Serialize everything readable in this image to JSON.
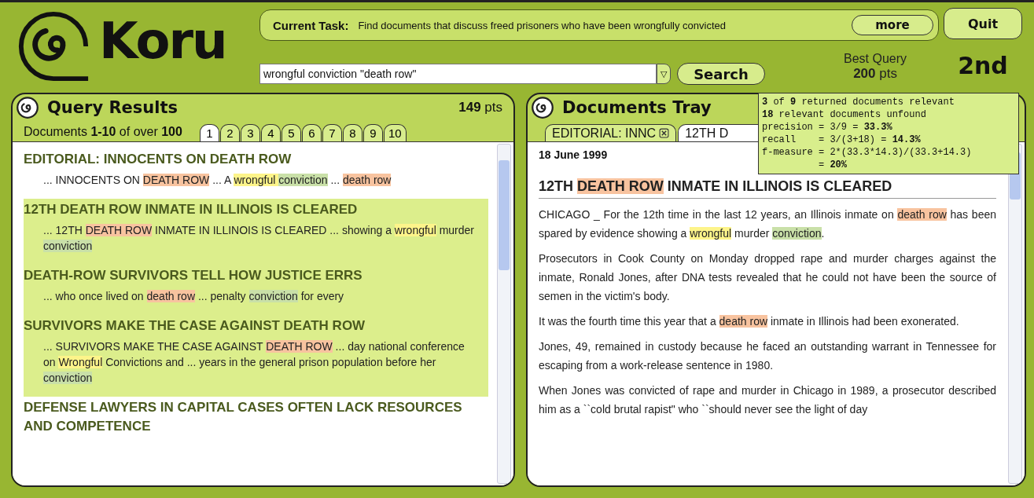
{
  "logo": {
    "text": "Koru"
  },
  "task": {
    "label": "Current Task:",
    "text": "Find documents that discuss freed prisoners who have been wrongfully convicted",
    "more_button": "more"
  },
  "quit_button": "Quit",
  "search": {
    "value": "wrongful conviction \"death row\"",
    "dropdown": "▽",
    "button": "Search"
  },
  "best_query": {
    "label": "Best Query",
    "points": "200",
    "unit": "pts"
  },
  "rank": "2nd",
  "score_tooltip": {
    "lines": [
      "**3** of **9** returned documents relevant",
      "**18** relevant documents unfound",
      "precision = 3/9 = **33.3%**",
      "recall    = 3/(3+18) = **14.3%**",
      "f-measure = 2*(33.3*14.3)/(33.3+14.3)",
      "          = **20%**"
    ]
  },
  "query_results": {
    "title": "Query Results",
    "points": "149",
    "unit": "pts",
    "summary": "Documents **1-10** of over **100**",
    "pages": [
      {
        "label": "1",
        "selected": true
      },
      {
        "label": "2",
        "selected": false
      },
      {
        "label": "3",
        "selected": false
      },
      {
        "label": "4",
        "selected": false
      },
      {
        "label": "5",
        "selected": false
      },
      {
        "label": "6",
        "selected": false
      },
      {
        "label": "7",
        "selected": false
      },
      {
        "label": "8",
        "selected": false
      },
      {
        "label": "9",
        "selected": false
      },
      {
        "label": "10",
        "selected": false
      }
    ],
    "results": [
      {
        "title": "EDITORIAL: INNOCENTS ON DEATH ROW",
        "highlighted": false,
        "snippet": [
          {
            "text": "... INNOCENTS ON "
          },
          {
            "text": "DEATH ROW",
            "color": "#f8c39f"
          },
          {
            "text": " ... A "
          },
          {
            "text": "wrongful ",
            "color": "#fdf48a"
          },
          {
            "text": "conviction",
            "color": "#c9e0a8"
          },
          {
            "text": " ... "
          },
          {
            "text": "death row",
            "color": "#f8c39f"
          }
        ]
      },
      {
        "title": "12TH DEATH ROW INMATE IN ILLINOIS IS CLEARED",
        "highlighted": true,
        "snippet": [
          {
            "text": "... 12TH "
          },
          {
            "text": "DEATH ROW",
            "color": "#f8c39f"
          },
          {
            "text": " INMATE IN ILLINOIS IS CLEARED ... showing a "
          },
          {
            "text": "wrongful",
            "color": "#fdf48a"
          },
          {
            "text": " murder "
          },
          {
            "text": "conviction",
            "color": "#c9e0a8"
          }
        ]
      },
      {
        "title": "DEATH-ROW SURVIVORS TELL HOW JUSTICE ERRS",
        "highlighted": true,
        "snippet": [
          {
            "text": "... who once lived on "
          },
          {
            "text": "death row",
            "color": "#f8c39f"
          },
          {
            "text": " ... penalty "
          },
          {
            "text": "conviction",
            "color": "#c9e0a8"
          },
          {
            "text": " for every"
          }
        ]
      },
      {
        "title": "SURVIVORS MAKE THE CASE AGAINST DEATH ROW",
        "highlighted": true,
        "snippet": [
          {
            "text": "... SURVIVORS MAKE THE CASE AGAINST "
          },
          {
            "text": "DEATH ROW",
            "color": "#f8c39f"
          },
          {
            "text": " ... day national conference on "
          },
          {
            "text": "Wrongful",
            "color": "#fdf48a"
          },
          {
            "text": " Convictions and ... years in the general prison population before her "
          },
          {
            "text": "conviction",
            "color": "#c9e0a8"
          }
        ]
      },
      {
        "title": "DEFENSE LAWYERS IN CAPITAL CASES OFTEN LACK RESOURCES AND COMPETENCE",
        "highlighted": false
      }
    ]
  },
  "documents_tray": {
    "title": "Documents Tray",
    "tabs": [
      {
        "label": "EDITORIAL: INNC",
        "selected": false,
        "closable": true
      },
      {
        "label": "12TH D",
        "selected": true,
        "closable": false
      }
    ],
    "document": {
      "date": "18 June 1999",
      "title": [
        {
          "text": "12TH "
        },
        {
          "text": "DEATH ROW",
          "color": "#f8c39f"
        },
        {
          "text": " INMATE IN ILLINOIS IS CLEARED"
        }
      ],
      "paragraphs": [
        [
          {
            "text": "CHICAGO _ For the 12th time in the last 12 years, an Illinois inmate on "
          },
          {
            "text": "death row",
            "color": "#f8c39f"
          },
          {
            "text": " has been spared by evidence showing a "
          },
          {
            "text": "wrongful",
            "color": "#fdf48a"
          },
          {
            "text": " murder "
          },
          {
            "text": "conviction",
            "color": "#c9e0a8"
          },
          {
            "text": "."
          }
        ],
        [
          {
            "text": "Prosecutors in Cook County on Monday dropped rape and murder charges against the inmate, Ronald Jones, after DNA tests revealed that he could not have been the source of semen in the victim's body."
          }
        ],
        [
          {
            "text": "It was the fourth time this year that a "
          },
          {
            "text": "death row",
            "color": "#f8c39f"
          },
          {
            "text": " inmate in Illinois had been exonerated."
          }
        ],
        [
          {
            "text": "Jones, 49, remained in custody because he faced an outstanding warrant in Tennessee for escaping from a work-release sentence in 1980."
          }
        ],
        [
          {
            "text": "When Jones was convicted of rape and murder in Chicago in 1989, a prosecutor described him as a ``cold brutal rapist\" who ``should never see the light of day"
          }
        ]
      ]
    }
  }
}
